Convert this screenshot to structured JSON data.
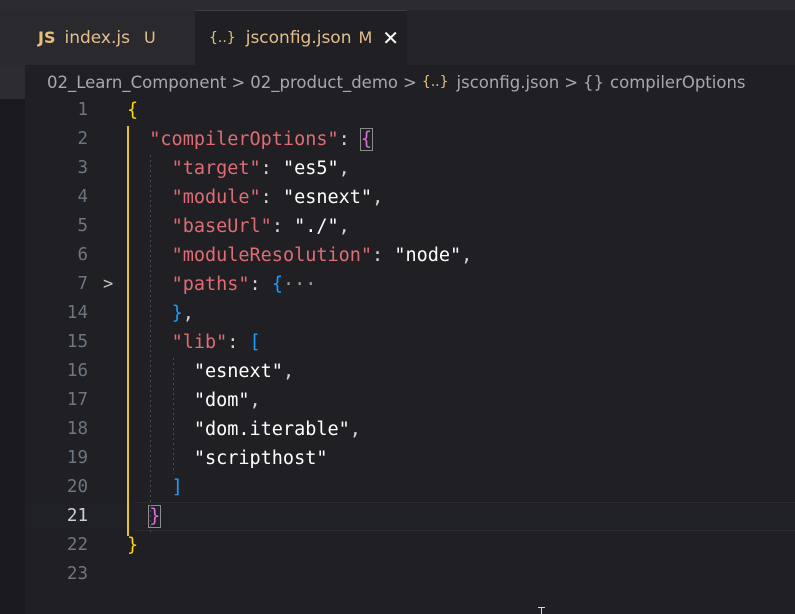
{
  "tabs": [
    {
      "icon": "JS",
      "label": "index.js",
      "status": "U"
    },
    {
      "icon": "{..}",
      "label": "jsconfig.json",
      "status": "M",
      "close": "✕"
    }
  ],
  "breadcrumb": {
    "items": [
      "02_Learn_Component",
      "02_product_demo",
      "jsconfig.json",
      "compilerOptions"
    ],
    "separator": ">",
    "json_icon": "{..}",
    "object_icon": "{}"
  },
  "editor": {
    "current_line": "21",
    "fold_marker": ">",
    "lines": [
      {
        "num": "1",
        "tokens": [
          {
            "t": "{",
            "c": "brace"
          }
        ]
      },
      {
        "num": "2",
        "tokens": [
          {
            "t": "  "
          },
          {
            "t": "\"compilerOptions\"",
            "c": "key"
          },
          {
            "t": ": ",
            "c": "punc"
          },
          {
            "t": "{",
            "c": "brace2",
            "box": true
          }
        ]
      },
      {
        "num": "3",
        "tokens": [
          {
            "t": "    "
          },
          {
            "t": "\"target\"",
            "c": "key"
          },
          {
            "t": ": ",
            "c": "punc"
          },
          {
            "t": "\"es5\"",
            "c": "str"
          },
          {
            "t": ",",
            "c": "punc"
          }
        ]
      },
      {
        "num": "4",
        "tokens": [
          {
            "t": "    "
          },
          {
            "t": "\"module\"",
            "c": "key"
          },
          {
            "t": ": ",
            "c": "punc"
          },
          {
            "t": "\"esnext\"",
            "c": "str"
          },
          {
            "t": ",",
            "c": "punc"
          }
        ]
      },
      {
        "num": "5",
        "tokens": [
          {
            "t": "    "
          },
          {
            "t": "\"baseUrl\"",
            "c": "key"
          },
          {
            "t": ": ",
            "c": "punc"
          },
          {
            "t": "\"./\"",
            "c": "str"
          },
          {
            "t": ",",
            "c": "punc"
          }
        ]
      },
      {
        "num": "6",
        "tokens": [
          {
            "t": "    "
          },
          {
            "t": "\"moduleResolution\"",
            "c": "key"
          },
          {
            "t": ": ",
            "c": "punc"
          },
          {
            "t": "\"node\"",
            "c": "str"
          },
          {
            "t": ",",
            "c": "punc"
          }
        ]
      },
      {
        "num": "7",
        "fold": true,
        "tokens": [
          {
            "t": "    "
          },
          {
            "t": "\"paths\"",
            "c": "key"
          },
          {
            "t": ": ",
            "c": "punc"
          },
          {
            "t": "{",
            "c": "brace3"
          },
          {
            "t": "···",
            "c": "ellipsis"
          }
        ]
      },
      {
        "num": "14",
        "tokens": [
          {
            "t": "    "
          },
          {
            "t": "}",
            "c": "brace3"
          },
          {
            "t": ",",
            "c": "punc"
          }
        ]
      },
      {
        "num": "15",
        "tokens": [
          {
            "t": "    "
          },
          {
            "t": "\"lib\"",
            "c": "key"
          },
          {
            "t": ": ",
            "c": "punc"
          },
          {
            "t": "[",
            "c": "brace3"
          }
        ]
      },
      {
        "num": "16",
        "tokens": [
          {
            "t": "      "
          },
          {
            "t": "\"esnext\"",
            "c": "str"
          },
          {
            "t": ",",
            "c": "punc"
          }
        ]
      },
      {
        "num": "17",
        "tokens": [
          {
            "t": "      "
          },
          {
            "t": "\"dom\"",
            "c": "str"
          },
          {
            "t": ",",
            "c": "punc"
          }
        ]
      },
      {
        "num": "18",
        "tokens": [
          {
            "t": "      "
          },
          {
            "t": "\"dom.iterable\"",
            "c": "str"
          },
          {
            "t": ",",
            "c": "punc"
          }
        ]
      },
      {
        "num": "19",
        "tokens": [
          {
            "t": "      "
          },
          {
            "t": "\"scripthost\"",
            "c": "str"
          }
        ]
      },
      {
        "num": "20",
        "tokens": [
          {
            "t": "    "
          },
          {
            "t": "]",
            "c": "brace3"
          }
        ]
      },
      {
        "num": "21",
        "tokens": [
          {
            "t": "  "
          },
          {
            "t": "}",
            "c": "brace2",
            "box": true
          }
        ]
      },
      {
        "num": "22",
        "tokens": [
          {
            "t": "}",
            "c": "brace"
          }
        ]
      },
      {
        "num": "23",
        "tokens": []
      }
    ]
  }
}
